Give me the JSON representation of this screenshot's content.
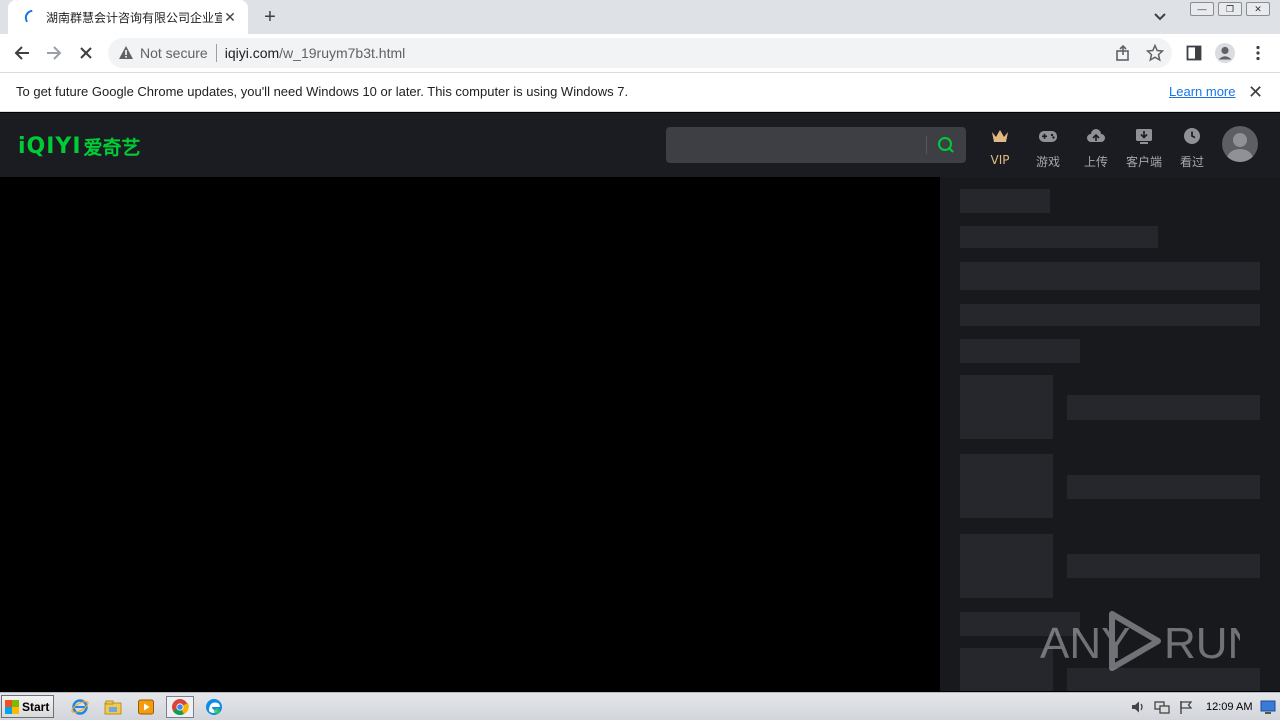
{
  "browser": {
    "tab_title": "湖南群慧会计咨询有限公司企业宣传",
    "omnibox": {
      "security_label": "Not secure",
      "url_host": "iqiyi.com",
      "url_path": "/w_19ruym7b3t.html"
    }
  },
  "infobar": {
    "message": "To get future Google Chrome updates, you'll need Windows 10 or later. This computer is using Windows 7.",
    "link_label": "Learn more"
  },
  "site": {
    "logo_latin": "iQIYI",
    "logo_cn": "爱奇艺",
    "search_placeholder": "",
    "nav": [
      {
        "label": "VIP",
        "icon": "crown-icon"
      },
      {
        "label": "游戏",
        "icon": "gamepad-icon"
      },
      {
        "label": "上传",
        "icon": "upload-cloud-icon"
      },
      {
        "label": "客户端",
        "icon": "download-icon"
      },
      {
        "label": "看过",
        "icon": "clock-icon"
      }
    ],
    "colors": {
      "brand": "#00cc36",
      "vip": "#e2b985",
      "header_bg": "#1a1c22"
    }
  },
  "watermark": {
    "left": "ANY",
    "right": "RUN"
  },
  "taskbar": {
    "start_label": "Start",
    "clock": "12:09 AM"
  }
}
